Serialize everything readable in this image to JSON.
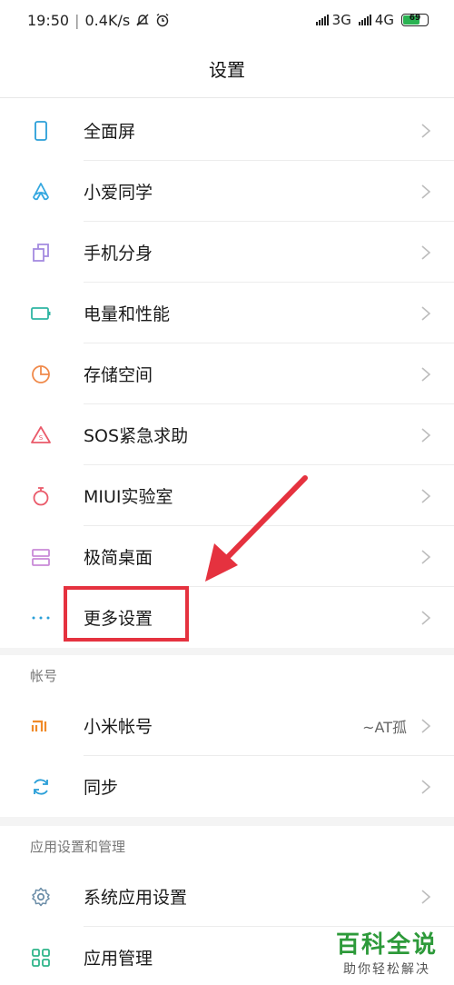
{
  "status_bar": {
    "time": "19:50",
    "speed": "0.4K/s",
    "net1": "3G",
    "net2": "4G",
    "battery": "69"
  },
  "header": {
    "title": "设置"
  },
  "group1": [
    {
      "label": "全面屏",
      "icon": "fullscreen-icon"
    },
    {
      "label": "小爱同学",
      "icon": "xiaoai-icon"
    },
    {
      "label": "手机分身",
      "icon": "second-space-icon"
    },
    {
      "label": "电量和性能",
      "icon": "battery-icon"
    },
    {
      "label": "存储空间",
      "icon": "storage-icon"
    },
    {
      "label": "SOS紧急求助",
      "icon": "sos-icon"
    },
    {
      "label": "MIUI实验室",
      "icon": "lab-icon"
    },
    {
      "label": "极简桌面",
      "icon": "desktop-icon"
    },
    {
      "label": "更多设置",
      "icon": "more-icon"
    }
  ],
  "account_section": {
    "header": "帐号",
    "items": [
      {
        "label": "小米帐号",
        "value": "~AT孤",
        "icon": "mi-account-icon"
      },
      {
        "label": "同步",
        "icon": "sync-icon"
      }
    ]
  },
  "apps_section": {
    "header": "应用设置和管理",
    "items": [
      {
        "label": "系统应用设置",
        "icon": "gear-icon"
      },
      {
        "label": "应用管理",
        "icon": "app-grid-icon"
      }
    ]
  },
  "watermark": {
    "main": "百科全说",
    "sub": "助你轻松解决"
  },
  "colors": {
    "annotation": "#e5323f",
    "watermark": "#2d9a3a"
  }
}
